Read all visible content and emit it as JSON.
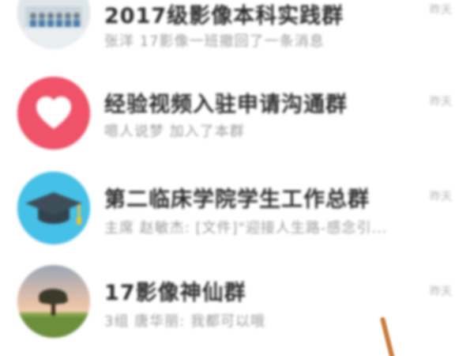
{
  "chats": [
    {
      "title": "2017级影像本科实践群",
      "subtitle": "张洋 17影像一班撤回了一条消息",
      "time": "昨天",
      "avatar_icon": "class-photo-icon"
    },
    {
      "title": "经验视频入驻申请沟通群",
      "subtitle": "嗯人说梦 加入了本群",
      "time": "昨天",
      "avatar_icon": "heart-icon",
      "avatar_color": "#ef5269"
    },
    {
      "title": "第二临床学院学生工作总群",
      "subtitle": "主席 赵敏杰: [文件]\"迎接人生路-感念引...",
      "time": "昨天",
      "avatar_icon": "graduation-cap-icon",
      "avatar_color": "#45c0e6"
    },
    {
      "title": "17影像神仙群",
      "subtitle": "3组 唐华丽: 我都可以哦",
      "time": "昨天",
      "avatar_icon": "tree-landscape-icon"
    }
  ]
}
